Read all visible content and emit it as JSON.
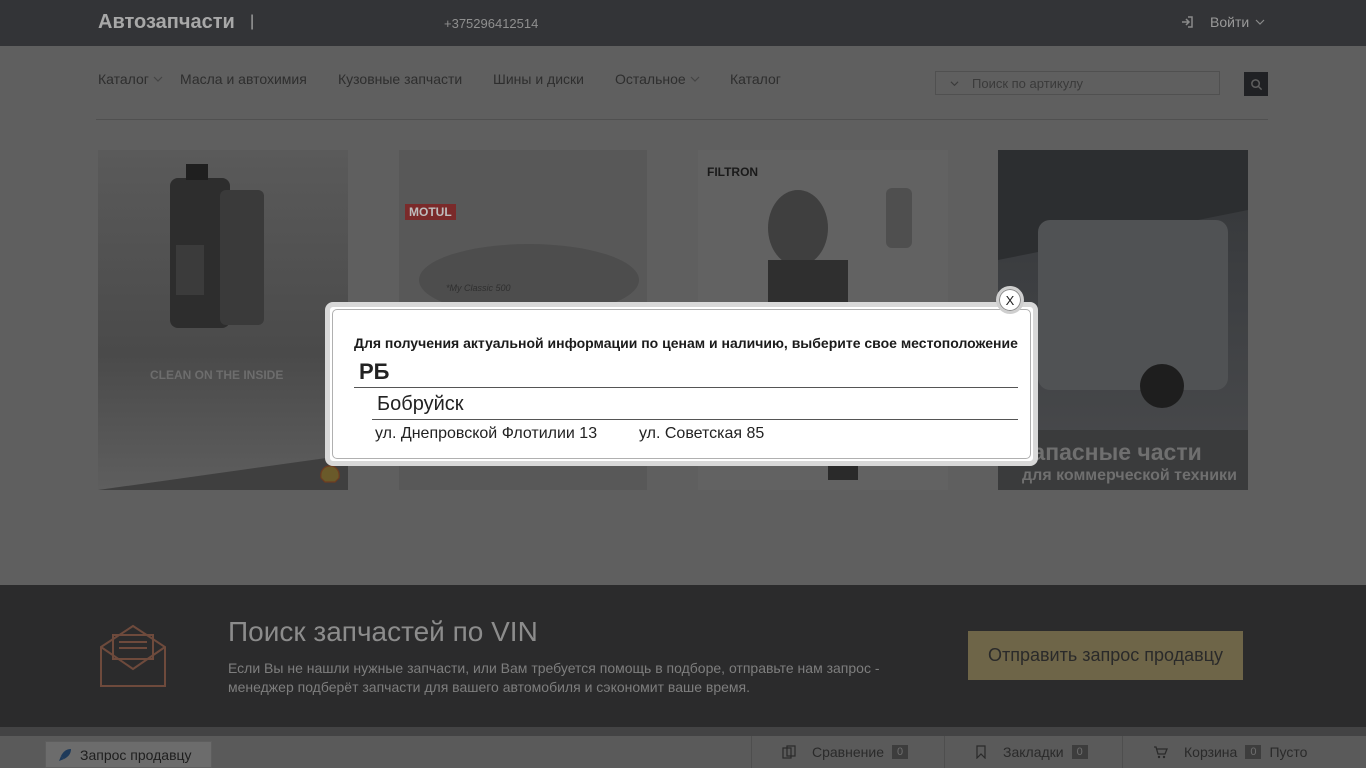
{
  "header": {
    "brand": "Автозапчасти",
    "separator": "|",
    "phone": "+375296412514",
    "login_label": "Войти"
  },
  "nav": {
    "items": [
      {
        "label": "Каталог",
        "has_dropdown": true
      },
      {
        "label": "Масла и автохимия",
        "has_dropdown": false
      },
      {
        "label": "Кузовные запчасти",
        "has_dropdown": false
      },
      {
        "label": "Шины и диски",
        "has_dropdown": false
      },
      {
        "label": "Остальное",
        "has_dropdown": true
      },
      {
        "label": "Каталог",
        "has_dropdown": false
      }
    ],
    "search_placeholder": "Поиск по артикулу"
  },
  "banners": [
    {
      "name": "shell-helix",
      "text": "CLEAN ON THE INSIDE"
    },
    {
      "name": "motul",
      "brand": "MOTUL",
      "text": "*My Classic 500"
    },
    {
      "name": "filtron",
      "brand": "FILTRON"
    },
    {
      "name": "commercial-parts",
      "text_line1": "Запасные части",
      "text_line2": "для коммерческой техники"
    }
  ],
  "vin_section": {
    "title": "Поиск запчастей по VIN",
    "description": "Если Вы не нашли нужные запчасти, или Вам требуется помощь в подборе, отправьте нам запрос - менеджер подберёт запчасти для вашего автомобиля и сэкономит ваше время.",
    "button_label": "Отправить запрос продавцу"
  },
  "bottom_bar": {
    "request_label": "Запрос продавцу",
    "compare_label": "Сравнение",
    "compare_count": "0",
    "bookmarks_label": "Закладки",
    "bookmarks_count": "0",
    "cart_label": "Корзина",
    "cart_count": "0",
    "cart_status": "Пусто"
  },
  "modal": {
    "close_label": "X",
    "title": "Для получения актуальной информации по ценам и наличию, выберите свое местоположение",
    "country": "РБ",
    "city": "Бобруйск",
    "addresses": [
      "ул. Днепровской Флотилии 13",
      "ул. Советская 85"
    ]
  },
  "colors": {
    "overlay_dark": "#333437",
    "vin_button": "#6e6548",
    "modal_bg": "#ffffff"
  }
}
